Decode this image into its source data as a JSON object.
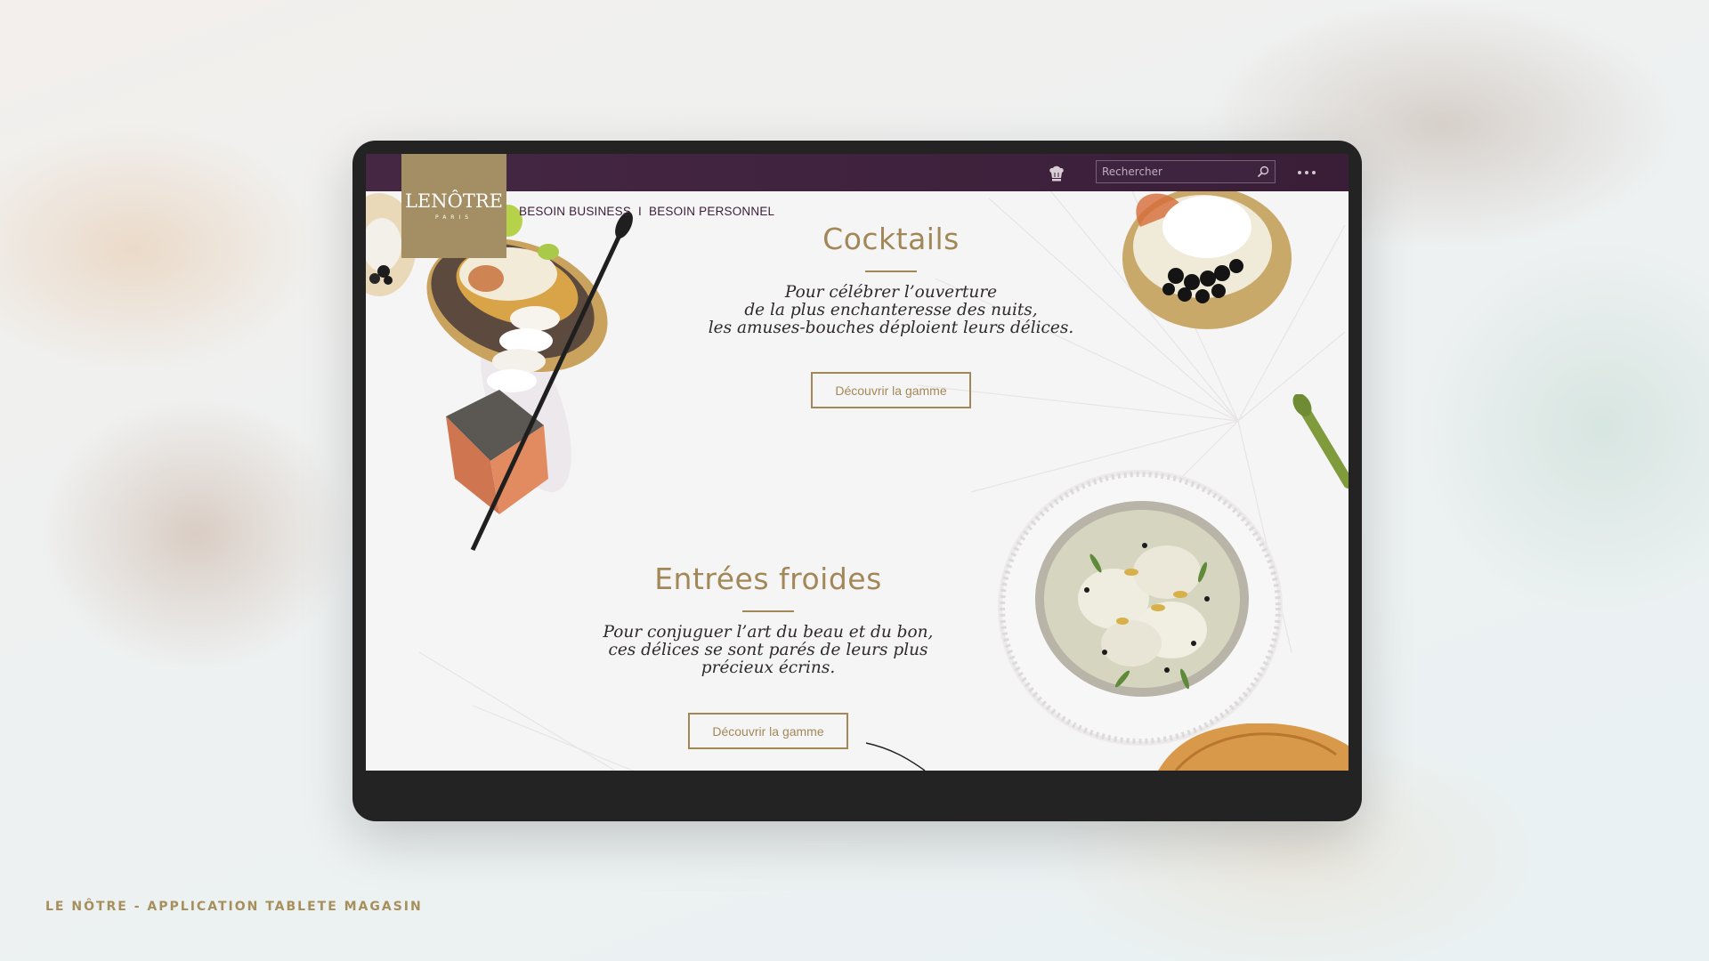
{
  "caption": "LE NÔTRE - APPLICATION TABLETE MAGASIN",
  "brand": {
    "logo_text": "LENÔTRE",
    "logo_sub": "PARIS"
  },
  "header": {
    "search_placeholder": "Rechercher",
    "icons": [
      "chef-hat-icon",
      "search-icon",
      "more-icon"
    ]
  },
  "nav": {
    "items": [
      "BESOIN BUSINESS",
      "BESOIN PERSONNEL"
    ],
    "separator": "I"
  },
  "sections": [
    {
      "title": "Cocktails",
      "lines": [
        "Pour célébrer l’ouverture",
        "de la plus enchanteresse des nuits,",
        "les amuses-bouches déploient leurs délices."
      ],
      "cta": "Découvrir la gamme"
    },
    {
      "title": "Entrées froides",
      "lines": [
        "Pour conjuguer l’art du beau et du bon,",
        "ces délices se sont parés de leurs plus",
        "précieux écrins."
      ],
      "cta": "Découvrir la gamme"
    }
  ],
  "colors": {
    "header": "#432542",
    "gold": "#a28858",
    "screen_bg": "#f6f5f5"
  }
}
